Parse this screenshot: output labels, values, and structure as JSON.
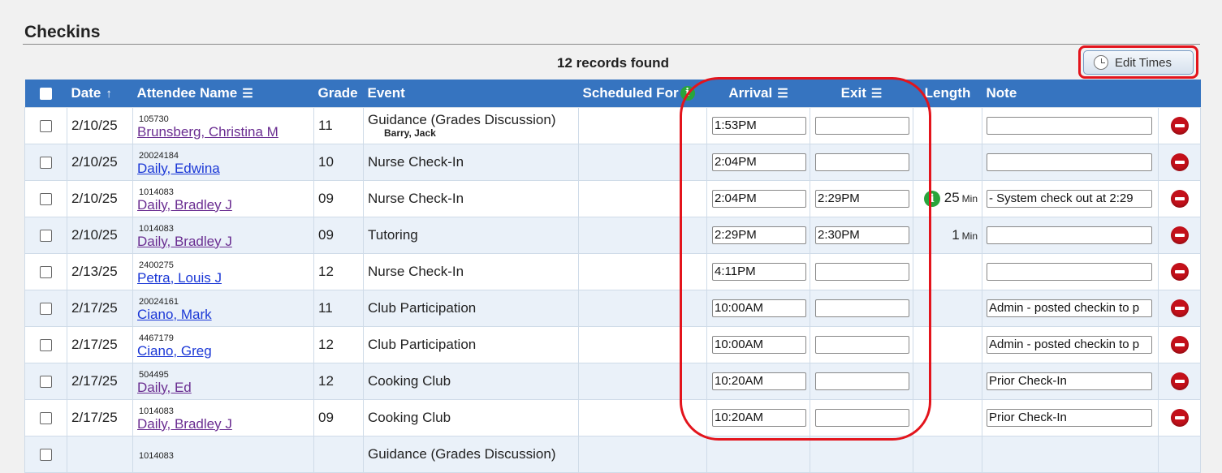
{
  "section_title": "Checkins",
  "records_found": "12 records found",
  "edit_times_label": "Edit Times",
  "columns": {
    "date": "Date",
    "date_sort": "↑",
    "attendee": "Attendee Name",
    "grade": "Grade",
    "event": "Event",
    "scheduled": "Scheduled For",
    "arrival": "Arrival",
    "exit": "Exit",
    "length": "Length",
    "note": "Note",
    "menu_glyph": "☰"
  },
  "colors": {
    "header_bg": "#3674c0",
    "highlight": "#e3141c",
    "info_green": "#29a53b",
    "delete_red": "#c4101a"
  },
  "rows": [
    {
      "date": "2/10/25",
      "id": "105730",
      "name": "Brunsberg, Christina M",
      "visited": true,
      "grade": "11",
      "event": "Guidance (Grades Discussion)",
      "staff": "Barry, Jack",
      "arrival": "1:53PM",
      "exit": "",
      "length": "",
      "length_unit": "",
      "length_info": false,
      "note": ""
    },
    {
      "date": "2/10/25",
      "id": "20024184",
      "name": "Daily, Edwina",
      "visited": false,
      "grade": "10",
      "event": "Nurse Check-In",
      "staff": "",
      "arrival": "2:04PM",
      "exit": "",
      "length": "",
      "length_unit": "",
      "length_info": false,
      "note": ""
    },
    {
      "date": "2/10/25",
      "id": "1014083",
      "name": "Daily, Bradley J",
      "visited": true,
      "grade": "09",
      "event": "Nurse Check-In",
      "staff": "",
      "arrival": "2:04PM",
      "exit": "2:29PM",
      "length": "25",
      "length_unit": "Min",
      "length_info": true,
      "note": "- System check out at 2:29"
    },
    {
      "date": "2/10/25",
      "id": "1014083",
      "name": "Daily, Bradley J",
      "visited": true,
      "grade": "09",
      "event": "Tutoring",
      "staff": "",
      "arrival": "2:29PM",
      "exit": "2:30PM",
      "length": "1",
      "length_unit": "Min",
      "length_info": false,
      "note": ""
    },
    {
      "date": "2/13/25",
      "id": "2400275",
      "name": "Petra, Louis J",
      "visited": false,
      "grade": "12",
      "event": "Nurse Check-In",
      "staff": "",
      "arrival": "4:11PM",
      "exit": "",
      "length": "",
      "length_unit": "",
      "length_info": false,
      "note": ""
    },
    {
      "date": "2/17/25",
      "id": "20024161",
      "name": "Ciano, Mark",
      "visited": false,
      "grade": "11",
      "event": "Club Participation",
      "staff": "",
      "arrival": "10:00AM",
      "exit": "",
      "length": "",
      "length_unit": "",
      "length_info": false,
      "note": "Admin - posted checkin to p"
    },
    {
      "date": "2/17/25",
      "id": "4467179",
      "name": "Ciano, Greg",
      "visited": false,
      "grade": "12",
      "event": "Club Participation",
      "staff": "",
      "arrival": "10:00AM",
      "exit": "",
      "length": "",
      "length_unit": "",
      "length_info": false,
      "note": "Admin - posted checkin to p"
    },
    {
      "date": "2/17/25",
      "id": "504495",
      "name": "Daily, Ed",
      "visited": true,
      "grade": "12",
      "event": "Cooking Club",
      "staff": "",
      "arrival": "10:20AM",
      "exit": "",
      "length": "",
      "length_unit": "",
      "length_info": false,
      "note": "Prior Check-In"
    },
    {
      "date": "2/17/25",
      "id": "1014083",
      "name": "Daily, Bradley J",
      "visited": true,
      "grade": "09",
      "event": "Cooking Club",
      "staff": "",
      "arrival": "10:20AM",
      "exit": "",
      "length": "",
      "length_unit": "",
      "length_info": false,
      "note": "Prior Check-In"
    },
    {
      "date": "",
      "id": "1014083",
      "name": "",
      "visited": true,
      "grade": "",
      "event": "Guidance (Grades Discussion)",
      "staff": "",
      "arrival": "",
      "exit": "",
      "length": "",
      "length_unit": "",
      "length_info": false,
      "note": ""
    }
  ]
}
